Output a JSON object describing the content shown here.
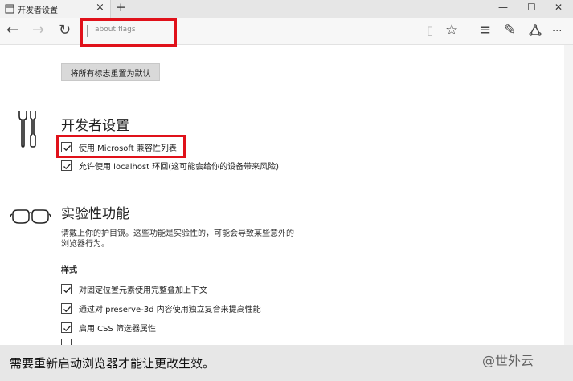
{
  "tab": {
    "title": "开发者设置",
    "close_glyph": "×",
    "new_tab_glyph": "+"
  },
  "window": {
    "minimize_glyph": "—",
    "maximize_glyph": "☐",
    "close_glyph": "✕"
  },
  "nav": {
    "back_glyph": "←",
    "forward_glyph": "→",
    "refresh_glyph": "↻",
    "reading_glyph": "▯",
    "favorite_glyph": "☆",
    "hub_glyph": "≡",
    "note_glyph": "✎",
    "share_glyph": "⌂",
    "more_glyph": "···"
  },
  "address": {
    "url": "about:flags"
  },
  "page": {
    "reset_button": "将所有标志重置为默认",
    "developer_section": {
      "title": "开发者设置",
      "options": [
        {
          "label": "使用 Microsoft 兼容性列表",
          "checked": true
        },
        {
          "label": "允许使用 localhost 环回(这可能会给你的设备带来风险)",
          "checked": true
        }
      ]
    },
    "experimental_section": {
      "title": "实验性功能",
      "description": "请戴上你的护目镜。这些功能是实验性的，可能会导致某些意外的浏览器行为。",
      "subheading": "样式",
      "options": [
        {
          "label": "对固定位置元素使用完整叠加上下文",
          "checked": true
        },
        {
          "label": "通过对 preserve-3d 内容使用独立复合来提高性能",
          "checked": true
        },
        {
          "label": "启用 CSS 筛选器属性",
          "checked": true
        }
      ]
    }
  },
  "notification": {
    "text": "需要重新启动浏览器才能让更改生效。"
  },
  "watermark": "@世外云",
  "colors": {
    "highlight": "#e0111a",
    "notification_bg": "#e7e7e7"
  }
}
